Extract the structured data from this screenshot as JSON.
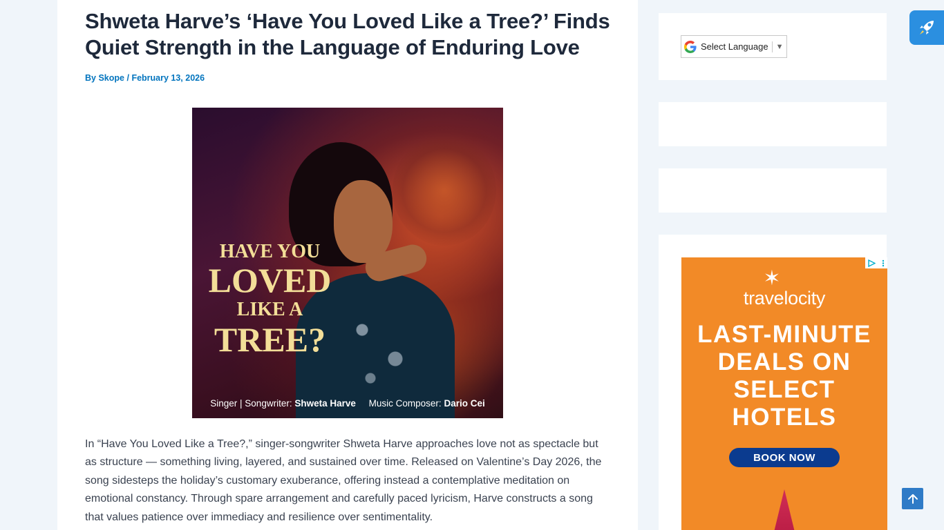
{
  "article": {
    "title": "Shweta Harve’s ‘Have You Loved Like a Tree?’ Finds Quiet Strength in the Language of Enduring Love",
    "meta": {
      "by": "By",
      "author": "Skope",
      "separator": "/",
      "date": "February 13, 2026"
    },
    "cover": {
      "line1": "HAVE YOU",
      "line2": "LOVED",
      "line3": "LIKE A",
      "line4": "TREE?",
      "credit_singer_label": "Singer | Songwriter:",
      "credit_singer": "Shweta Harve",
      "credit_composer_label": "Music Composer:",
      "credit_composer": "Dario Cei"
    },
    "body": "In “Have You Loved Like a Tree?,” singer-songwriter Shweta Harve approaches love not as spectacle but as structure — something living, layered, and sustained over time. Released on Valentine’s Day 2026, the song sidesteps the holiday’s customary exuberance, offering instead a contemplative meditation on emotional constancy. Through spare arrangement and carefully paced lyricism, Harve constructs a song that values patience over immediacy and resilience over sentimentality."
  },
  "sidebar": {
    "language_select": {
      "label": "Select Language",
      "arrow": "▼",
      "icon": "google-g-icon"
    },
    "ad": {
      "brand": "travelocity",
      "headline_1": "LAST-MINUTE",
      "headline_2": "DEALS ON",
      "headline_3": "SELECT",
      "headline_4": "HOTELS",
      "cta": "BOOK NOW",
      "bg_color": "#f28a27",
      "cta_color": "#0b3b8f"
    }
  },
  "floating": {
    "rocket_icon": "rocket-icon",
    "scroll_top_icon": "arrow-up-icon",
    "accent": "#2b8fe0"
  }
}
